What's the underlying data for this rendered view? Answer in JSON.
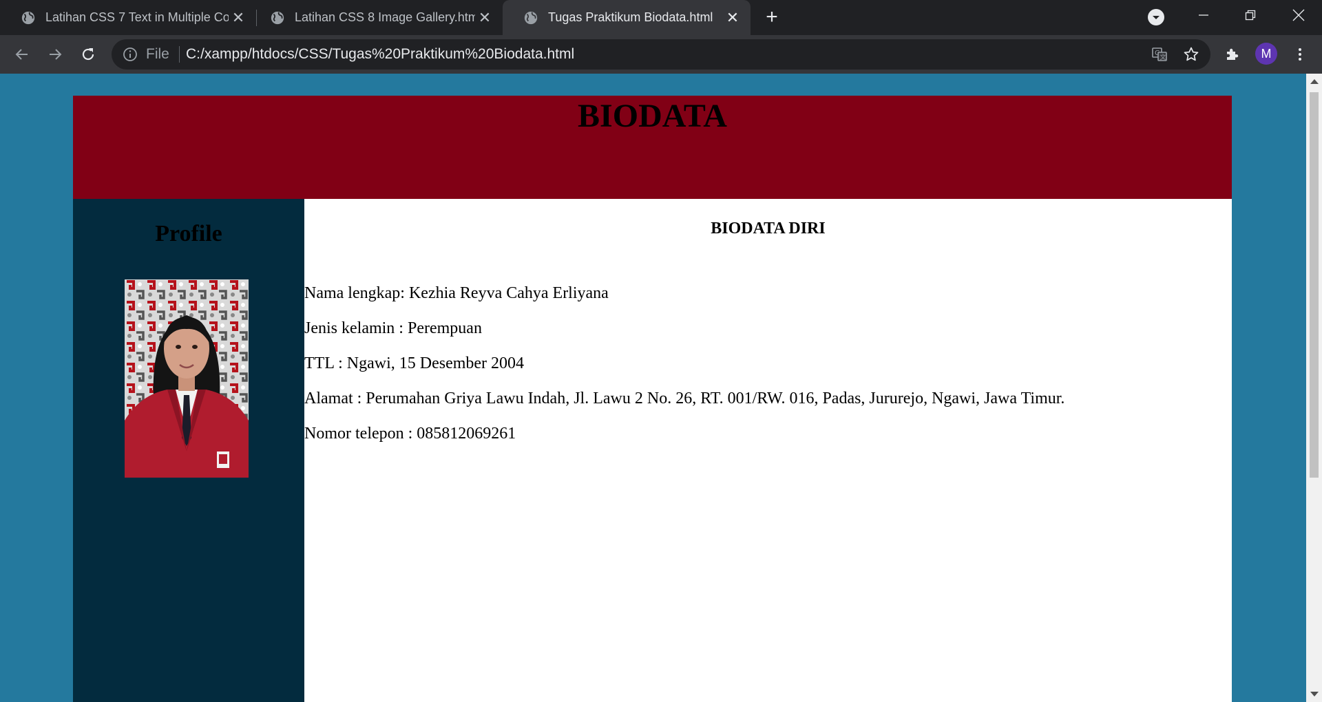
{
  "browser": {
    "tabs": [
      {
        "title": "Latihan CSS 7 Text in Multiple Co",
        "active": false
      },
      {
        "title": "Latihan CSS 8 Image Gallery.html",
        "active": false
      },
      {
        "title": "Tugas Praktikum Biodata.html",
        "active": true
      }
    ],
    "address": {
      "scheme_label": "File",
      "url": "C:/xampp/htdocs/CSS/Tugas%20Praktikum%20Biodata.html"
    },
    "profile_initial": "M",
    "colors": {
      "profile_avatar": "#5e35b1",
      "tabstrip": "#202124",
      "toolbar": "#35363a"
    }
  },
  "page": {
    "header_title": "BIODATA",
    "sidebar_title": "Profile",
    "section_title": "BIODATA DIRI",
    "fields": [
      {
        "text": "Nama lengkap: Kezhia Reyva Cahya Erliyana"
      },
      {
        "text": "Jenis kelamin : Perempuan"
      },
      {
        "text": "TTL : Ngawi, 15 Desember 2004"
      },
      {
        "text": "Alamat : Perumahan Griya Lawu Indah, Jl. Lawu 2 No. 26, RT. 001/RW. 016, Padas, Jururejo, Ngawi, Jawa Timur."
      },
      {
        "text": "Nomor telepon : 085812069261"
      }
    ],
    "colors": {
      "background": "#24799e",
      "header": "#810015",
      "sidebar": "#032b3e",
      "main": "#ffffff"
    }
  }
}
